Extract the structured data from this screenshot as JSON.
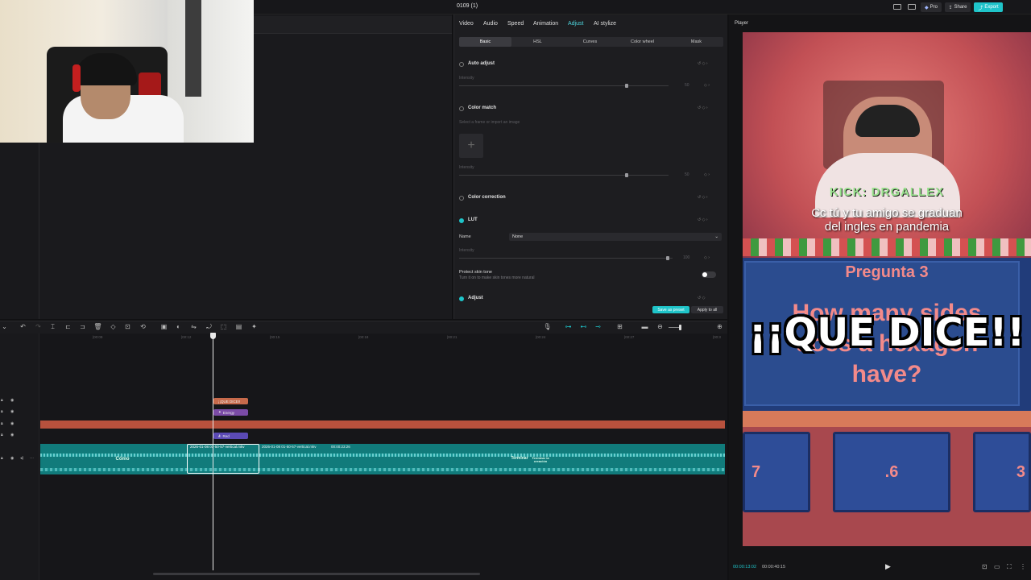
{
  "window": {
    "project_title": "0109 (1)"
  },
  "topbar": {
    "pro_label": "Pro",
    "share_label": "Share",
    "export_label": "Export",
    "accent": "#1fc4c9"
  },
  "inspector": {
    "tabs": [
      "Video",
      "Audio",
      "Speed",
      "Animation",
      "Adjust",
      "AI stylize"
    ],
    "active_tab": "Adjust",
    "subtabs": [
      "Basic",
      "HSL",
      "Curves",
      "Color wheel",
      "Mask"
    ],
    "active_subtab": "Basic",
    "auto_adjust": {
      "label": "Auto adjust",
      "intensity_label": "Intensity",
      "value": "50"
    },
    "color_match": {
      "label": "Color match",
      "hint": "Select a frame or import an image",
      "intensity_label": "Intensity",
      "value": "50"
    },
    "color_correction": {
      "label": "Color correction"
    },
    "lut": {
      "label": "LUT",
      "name_label": "Name",
      "name_value": "None",
      "intensity_label": "Intensity",
      "value": "100"
    },
    "protect_skin": {
      "label": "Protect skin tone",
      "hint": "Turn it on to make skin tones more natural"
    },
    "adjust": {
      "label": "Adjust"
    },
    "save_preset_label": "Save as preset",
    "apply_all_label": "Apply to all"
  },
  "player": {
    "label": "Player",
    "current_time": "00:00:13:02",
    "total_time": "00:00:40:15",
    "overlay_banner": "KICK: DRGALLEX",
    "subtitle_line1": "Cc tú y tu amigo se graduan",
    "subtitle_line2": "del ingles en pandemia",
    "question_title": "Pregunta 3",
    "question_text_line1": "How many sides",
    "question_text_line2": "does a hexagon",
    "question_text_line3": "have?",
    "big_overlay": "¡¡QUE DICE!!",
    "answer_left": "7",
    "answer_mid": ".6",
    "answer_right": "3"
  },
  "timeline": {
    "ruler": [
      "|00:09",
      "|00:12",
      "|00:15",
      "|00:18",
      "|00:21",
      "|00:24",
      "|00:27",
      "|00:3"
    ],
    "clips": {
      "text_clip": "¡¡QUE DICE!!",
      "effect_clip": "Energy",
      "filter_clip": "Red",
      "main_clip_a": "2026-01-08 01-50-57-vertical.mkv",
      "main_clip_b": "2026-01-08 01-50-57-vertical.mkv",
      "main_clip_b_duration": "00:00:23:26"
    },
    "thumb_words": [
      "Cómo",
      "Cómo",
      "Terminar",
      "Terminar la creación"
    ]
  }
}
